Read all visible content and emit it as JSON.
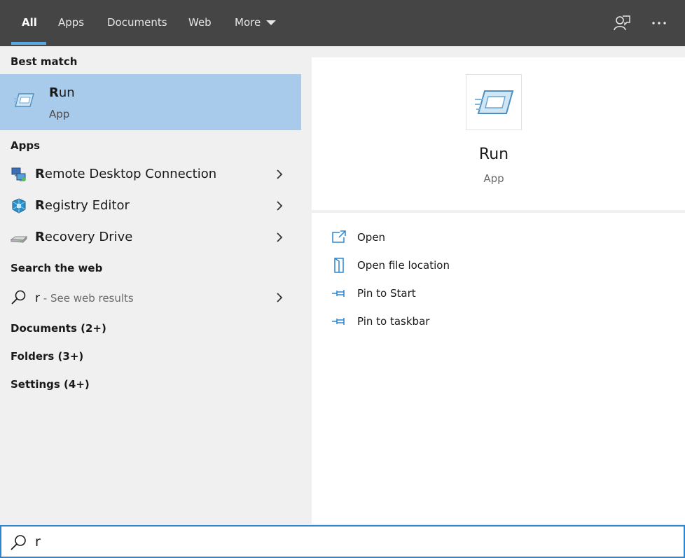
{
  "tabs": [
    {
      "label": "All",
      "active": true
    },
    {
      "label": "Apps"
    },
    {
      "label": "Documents"
    },
    {
      "label": "Web"
    },
    {
      "label": "More"
    }
  ],
  "icons": {
    "feedback": "feedback-icon",
    "more_options": "ellipsis-icon",
    "search": "search-icon"
  },
  "best_match": {
    "header": "Best match",
    "title_highlight": "R",
    "title_rest": "un",
    "subtitle": "App"
  },
  "apps": {
    "header": "Apps",
    "items": [
      {
        "highlight": "R",
        "rest": "emote Desktop Connection",
        "icon": "remote-desktop-icon"
      },
      {
        "highlight": "R",
        "rest": "egistry Editor",
        "icon": "registry-editor-icon"
      },
      {
        "highlight": "R",
        "rest": "ecovery Drive",
        "icon": "recovery-drive-icon"
      }
    ]
  },
  "web": {
    "header": "Search the web",
    "query": "r",
    "hint": " - See web results"
  },
  "categories": [
    {
      "label": "Documents (2+)"
    },
    {
      "label": "Folders (3+)"
    },
    {
      "label": "Settings (4+)"
    }
  ],
  "preview": {
    "title": "Run",
    "subtitle": "App",
    "actions": [
      {
        "label": "Open",
        "icon": "open-icon"
      },
      {
        "label": "Open file location",
        "icon": "file-location-icon"
      },
      {
        "label": "Pin to Start",
        "icon": "pin-icon"
      },
      {
        "label": "Pin to taskbar",
        "icon": "pin-icon"
      }
    ]
  },
  "search": {
    "value": "r"
  },
  "colors": {
    "topbar": "#454545",
    "accent": "#58a9e3",
    "selection": "#a8cbeb",
    "search_border": "#2c85d0"
  }
}
